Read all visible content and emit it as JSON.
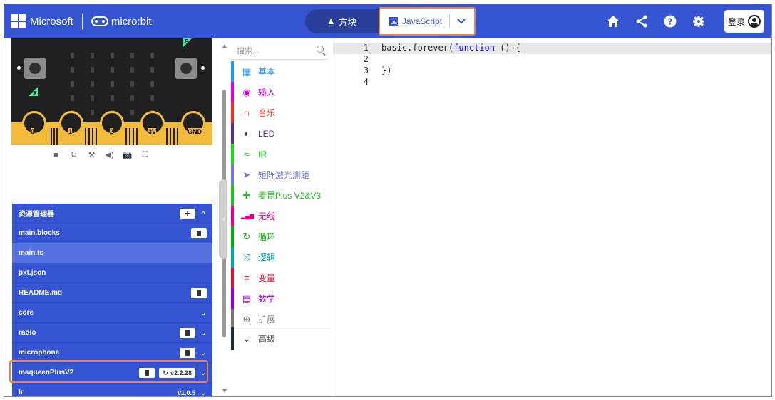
{
  "header": {
    "brand": "Microsoft",
    "product": "micro:bit",
    "blocks_tab": "方块",
    "js_tab": "JavaScript",
    "login": "登录",
    "icons": [
      "home-icon",
      "share-icon",
      "help-icon",
      "settings-icon"
    ]
  },
  "simulator": {
    "pins": [
      "0",
      "1",
      "2",
      "3V",
      "GND"
    ],
    "button_a": "A",
    "button_b": "B",
    "toolbar": [
      "■",
      "↻",
      "⚒",
      "◀)",
      "📷",
      "⛶"
    ]
  },
  "explorer": {
    "title": "资源管理器",
    "files": [
      {
        "name": "main.blocks"
      },
      {
        "name": "main.ts"
      },
      {
        "name": "pxt.json"
      },
      {
        "name": "README.md"
      }
    ],
    "packages": [
      {
        "name": "core"
      },
      {
        "name": "radio"
      },
      {
        "name": "microphone"
      },
      {
        "name": "maqueenPlusV2",
        "version": "v2.2.28"
      },
      {
        "name": "Ir",
        "version": "v1.0.5"
      }
    ]
  },
  "toolbox": {
    "search_placeholder": "搜索...",
    "categories": [
      {
        "label": "基本",
        "color": "#1e90ff",
        "icon": "grid-icon"
      },
      {
        "label": "输入",
        "color": "#d400d4",
        "icon": "circle-icon"
      },
      {
        "label": "音乐",
        "color": "#e63022",
        "icon": "headphones-icon"
      },
      {
        "label": "LED",
        "color": "#5c2d91",
        "icon": "toggle-icon"
      },
      {
        "label": "IR",
        "color": "#20d820",
        "icon": "wifi-icon"
      },
      {
        "label": "矩阵激光测距",
        "color": "#6e79d8",
        "icon": "arrow-icon"
      },
      {
        "label": "麦昆Plus V2&V3",
        "color": "#20c020",
        "icon": "plus-icon"
      },
      {
        "label": "无线",
        "color": "#e3008c",
        "icon": "signal-icon"
      },
      {
        "label": "循环",
        "color": "#00aa00",
        "icon": "loop-icon"
      },
      {
        "label": "逻辑",
        "color": "#00a4a6",
        "icon": "shuffle-icon"
      },
      {
        "label": "变量",
        "color": "#dc143c",
        "icon": "list-icon"
      },
      {
        "label": "数学",
        "color": "#9400d3",
        "icon": "calculator-icon"
      },
      {
        "label": "扩展",
        "color": "#777777",
        "icon": "add-circle-icon"
      },
      {
        "label": "高级",
        "color": "#1a2b3c",
        "icon": "chevron-down-icon"
      }
    ]
  },
  "editor": {
    "lines": [
      {
        "num": "1",
        "pre": "basic.forever(",
        "kw": "function",
        "post": " () {"
      },
      {
        "num": "2",
        "pre": "",
        "kw": "",
        "post": ""
      },
      {
        "num": "3",
        "pre": "})",
        "kw": "",
        "post": ""
      },
      {
        "num": "4",
        "pre": "",
        "kw": "",
        "post": ""
      }
    ]
  }
}
